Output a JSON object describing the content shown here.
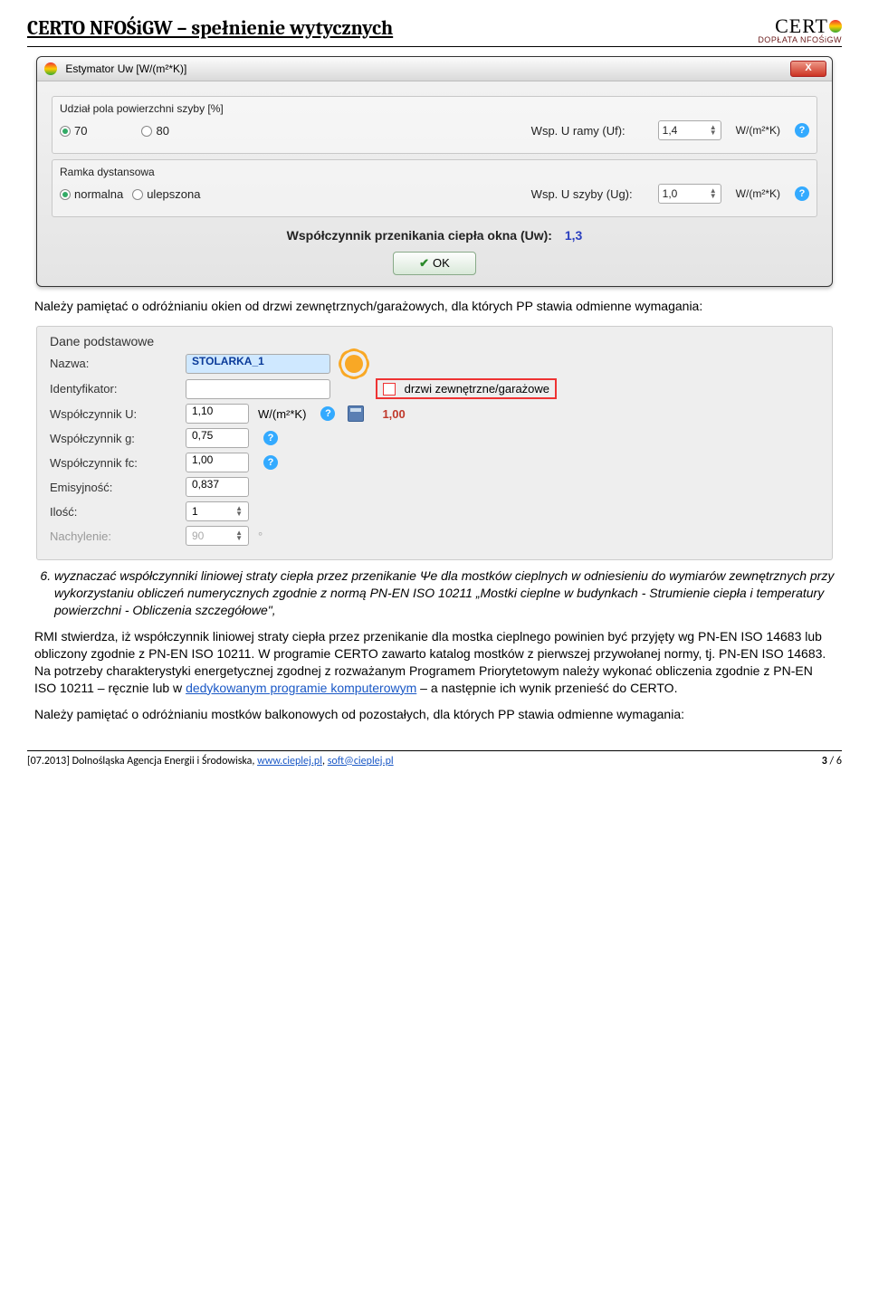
{
  "header": {
    "title": "CERTO NFOŚiGW – spełnienie wytycznych",
    "logo_main": "CERT",
    "logo_sub": "DOPŁATA NFOŚiGW"
  },
  "win1": {
    "title": "Estymator Uw [W/(m²*K)]",
    "close": "X",
    "group1_label": "Udział pola powierzchni szyby [%]",
    "opt70": "70",
    "opt80": "80",
    "uf_label": "Wsp. U ramy (Uf):",
    "uf_value": "1,4",
    "uf_unit": "W/(m²*K)",
    "group2_label": "Ramka dystansowa",
    "opt_norm": "normalna",
    "opt_ulep": "ulepszona",
    "ug_label": "Wsp. U szyby (Ug):",
    "ug_value": "1,0",
    "ug_unit": "W/(m²*K)",
    "result_label": "Współczynnik przenikania ciepła okna (Uw):",
    "result_value": "1,3",
    "ok": "OK"
  },
  "para1": "Należy pamiętać o odróżnianiu okien od drzwi zewnętrznych/garażowych, dla których PP stawia odmienne wymagania:",
  "panel": {
    "heading": "Dane podstawowe",
    "nazwa_label": "Nazwa:",
    "nazwa_value": "STOLARKA_1",
    "ident_label": "Identyfikator:",
    "drzwi_label": "drzwi zewnętrzne/garażowe",
    "u_label": "Współczynnik U:",
    "u_value": "1,10",
    "u_unit": "W/(m²*K)",
    "u_red": "1,00",
    "g_label": "Współczynnik g:",
    "g_value": "0,75",
    "fc_label": "Współczynnik fc:",
    "fc_value": "1,00",
    "emis_label": "Emisyjność:",
    "emis_value": "0,837",
    "ilosc_label": "Ilość:",
    "ilosc_value": "1",
    "nach_label": "Nachylenie:",
    "nach_value": "90",
    "nach_unit": "°"
  },
  "list6": "wyznaczać współczynniki liniowej straty ciepła przez przenikanie Ψe dla mostków cieplnych w odniesieniu do wymiarów zewnętrznych przy wykorzystaniu obliczeń numerycznych zgodnie z normą PN-EN ISO 10211 „Mostki cieplne w budynkach - Strumienie ciepła i temperatury powierzchni - Obliczenia szczegółowe\",",
  "body2a": "RMI stwierdza, iż współczynnik liniowej straty ciepła przez przenikanie dla mostka cieplnego powinien być przyjęty wg PN-EN ISO 14683 lub obliczony zgodnie z PN-EN ISO 10211. W programie CERTO zawarto katalog mostków z pierwszej przywołanej normy, tj. PN-EN ISO 14683. Na potrzeby charakterystyki energetycznej zgodnej z rozważanym Programem Priorytetowym należy wykonać obliczenia zgodnie z PN-EN ISO 10211 – ręcznie lub w ",
  "body2_link": "dedykowanym programie komputerowym",
  "body2b": " – a następnie ich wynik przenieść do CERTO.",
  "body3": "Należy pamiętać o odróżnianiu mostków balkonowych od pozostałych, dla których PP stawia odmienne wymagania:",
  "footer": {
    "left_prefix": "[07.2013] Dolnośląska Agencja Energii i Środowiska, ",
    "link1": "www.cieplej.pl",
    "sep": ", ",
    "link2": "soft@cieplej.pl",
    "page_cur": "3",
    "page_sep": " / ",
    "page_tot": "6"
  }
}
